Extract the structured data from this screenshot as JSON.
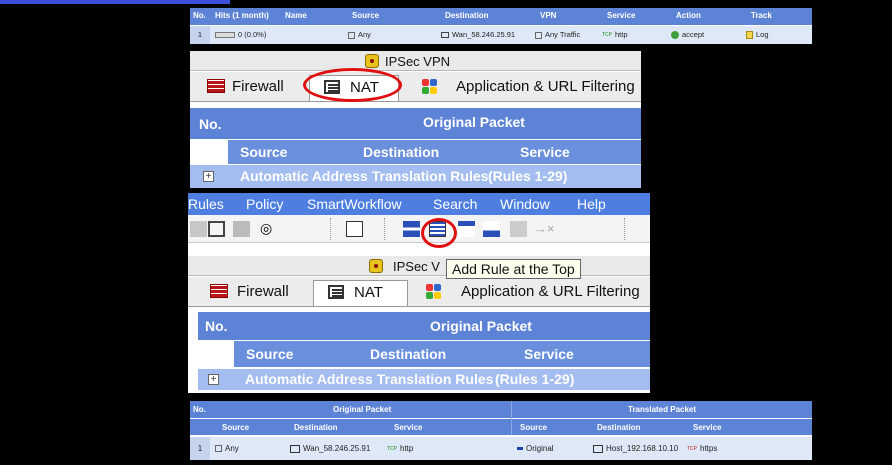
{
  "rule_row": {
    "headers": [
      "No.",
      "Hits (1 month)",
      "Name",
      "Source",
      "Destination",
      "VPN",
      "Service",
      "Action",
      "Track"
    ],
    "number": "1",
    "hits": "0 (0.0%)",
    "name": "",
    "source": "Any",
    "destination": "Wan_58.246.25.91",
    "vpn": "Any Traffic",
    "service": "http",
    "action": "accept",
    "track": "Log"
  },
  "panel_a": {
    "window_title": "IPSec VPN",
    "tabs": [
      "Firewall",
      "NAT",
      "Application & URL Filtering"
    ],
    "col_no": "No.",
    "group_header": "Original Packet",
    "sub_cols": [
      "Source",
      "Destination",
      "Service"
    ],
    "section": "Automatic Address Translation Rules",
    "section_count": "(Rules 1-29)"
  },
  "panel_b": {
    "menu": [
      "Rules",
      "Policy",
      "SmartWorkflow",
      "Search",
      "Window",
      "Help"
    ],
    "window_title": "IPSec V",
    "tooltip": "Add Rule at the Top",
    "tabs": [
      "Firewall",
      "NAT",
      "Application & URL Filtering"
    ],
    "col_no": "No.",
    "group_header": "Original Packet",
    "sub_cols": [
      "Source",
      "Destination",
      "Service"
    ],
    "section": "Automatic Address Translation Rules",
    "section_count": "(Rules 1-29)"
  },
  "nat_row": {
    "col_no": "No.",
    "original": "Original Packet",
    "translated": "Translated Packet",
    "sub_cols": [
      "Source",
      "Destination",
      "Service",
      "Source",
      "Destination",
      "Service"
    ],
    "number": "1",
    "orig_source": "Any",
    "orig_destination": "Wan_58.246.25.91",
    "orig_service": "http",
    "trans_source": "Original",
    "trans_destination": "Host_192.168.10.10",
    "trans_service": "https"
  },
  "colors": {
    "header_blue": "#5d83d6",
    "section_blue": "#a4bdf0",
    "highlight": "#e01010"
  }
}
